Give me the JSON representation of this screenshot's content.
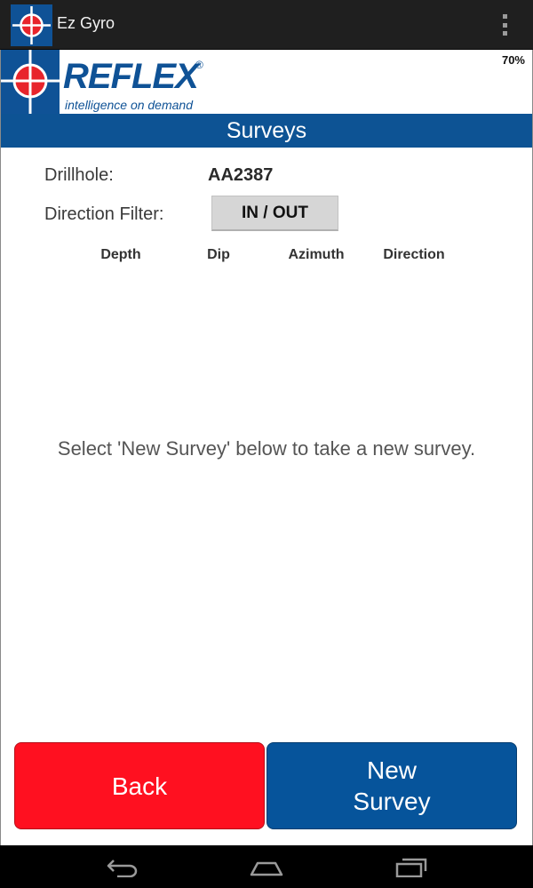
{
  "app": {
    "title": "Ez Gyro",
    "icon": "reflex-crosshair-icon"
  },
  "status": {
    "battery": "70%"
  },
  "brand": {
    "name": "REFLEX",
    "registered": "®",
    "tagline": "intelligence on demand",
    "color": "#0f5296"
  },
  "screen": {
    "title": "Surveys",
    "title_bar_color": "#0d5394"
  },
  "drillhole": {
    "label": "Drillhole:",
    "value": "AA2387"
  },
  "direction_filter": {
    "label": "Direction Filter:",
    "value": "IN / OUT"
  },
  "table": {
    "columns": [
      "Depth",
      "Dip",
      "Azimuth",
      "Direction"
    ],
    "rows": []
  },
  "empty_message": "Select 'New Survey' below to take a new survey.",
  "buttons": {
    "back": {
      "label": "Back",
      "color": "#ff1020"
    },
    "new_survey": {
      "label": "New Survey",
      "color": "#06549b"
    }
  },
  "nav": {
    "icons": [
      "back-icon",
      "home-icon",
      "recent-apps-icon"
    ]
  }
}
